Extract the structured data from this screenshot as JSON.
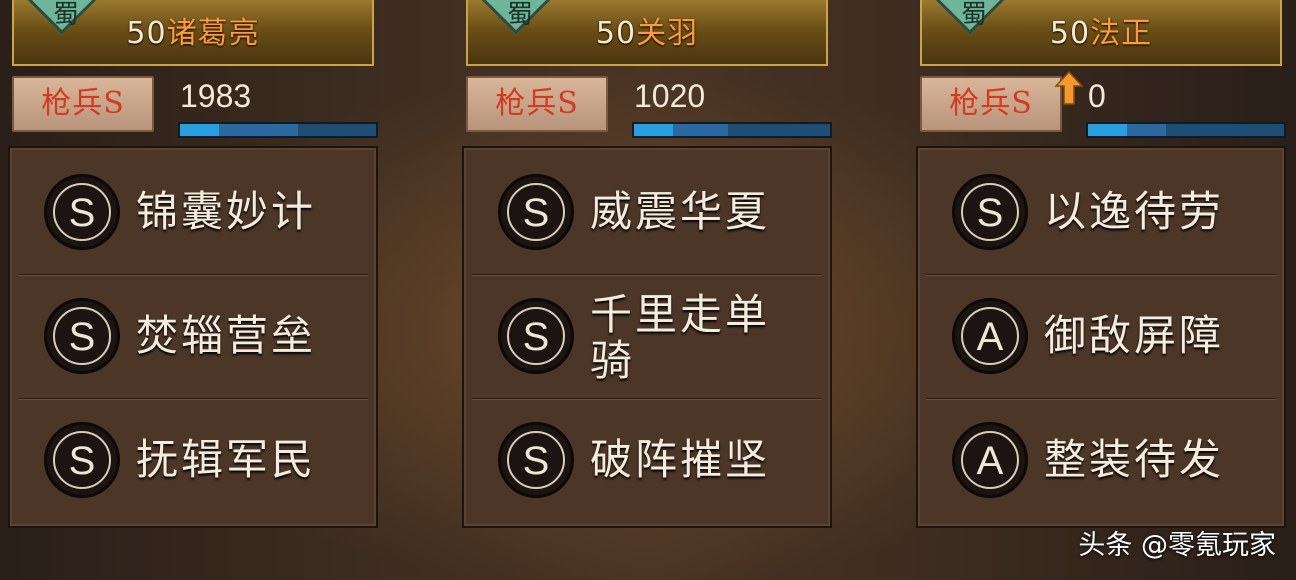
{
  "cards": [
    {
      "faction_char": "蜀",
      "level": "50",
      "hero_name": "诸葛亮",
      "troop_type": "枪兵S",
      "troop_count": "1983",
      "troop_bar_fraction": 0.6,
      "skills": [
        {
          "grade": "S",
          "name": "锦囊妙计"
        },
        {
          "grade": "S",
          "name": "焚辎营垒"
        },
        {
          "grade": "S",
          "name": "抚辑军民"
        }
      ]
    },
    {
      "faction_char": "蜀",
      "level": "50",
      "hero_name": "关羽",
      "troop_type": "枪兵S",
      "troop_count": "1020",
      "troop_bar_fraction": 0.48,
      "skills": [
        {
          "grade": "S",
          "name": "威震华夏"
        },
        {
          "grade": "S",
          "name": "千里走单骑"
        },
        {
          "grade": "S",
          "name": "破阵摧坚"
        }
      ]
    },
    {
      "faction_char": "蜀",
      "level": "50",
      "hero_name": "法正",
      "troop_type": "枪兵S",
      "troop_count": "0",
      "troop_bar_fraction": 0.4,
      "skills": [
        {
          "grade": "S",
          "name": "以逸待劳"
        },
        {
          "grade": "A",
          "name": "御敌屏障"
        },
        {
          "grade": "A",
          "name": "整装待发"
        }
      ]
    }
  ],
  "watermark": "头条 @零氪玩家"
}
